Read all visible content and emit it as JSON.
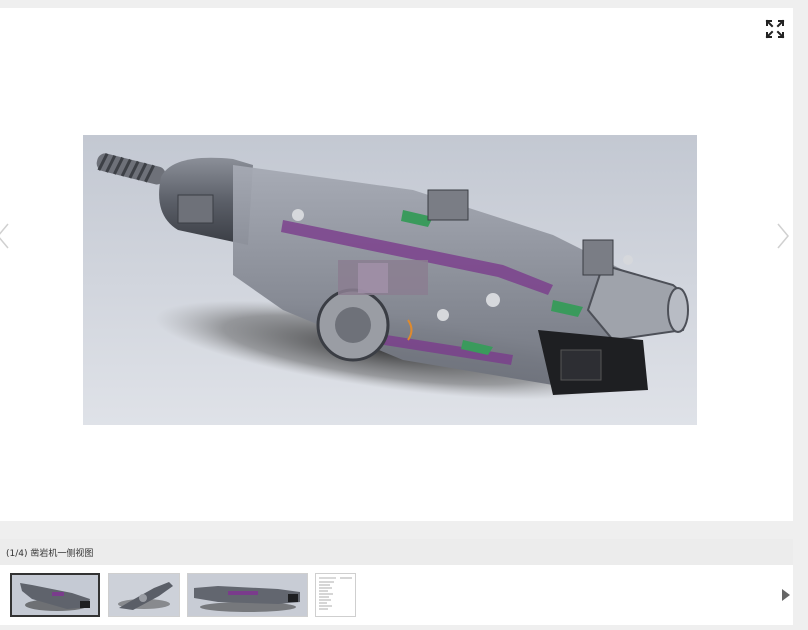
{
  "viewer": {
    "caption": "(1/4) 凿岩机一侧视图",
    "icons": {
      "fullscreen": "fullscreen-icon",
      "prev": "chevron-left-icon",
      "next": "chevron-right-icon",
      "strip_next": "triangle-right-icon"
    },
    "image_alt_blur_note": ""
  },
  "thumbnails": [
    {
      "active": true
    },
    {
      "active": false
    },
    {
      "active": false
    },
    {
      "active": false
    }
  ],
  "colors": {
    "image_bg": "#c7ccd6",
    "frame_bg": "#ffffff",
    "caption_bg": "#ececec"
  }
}
